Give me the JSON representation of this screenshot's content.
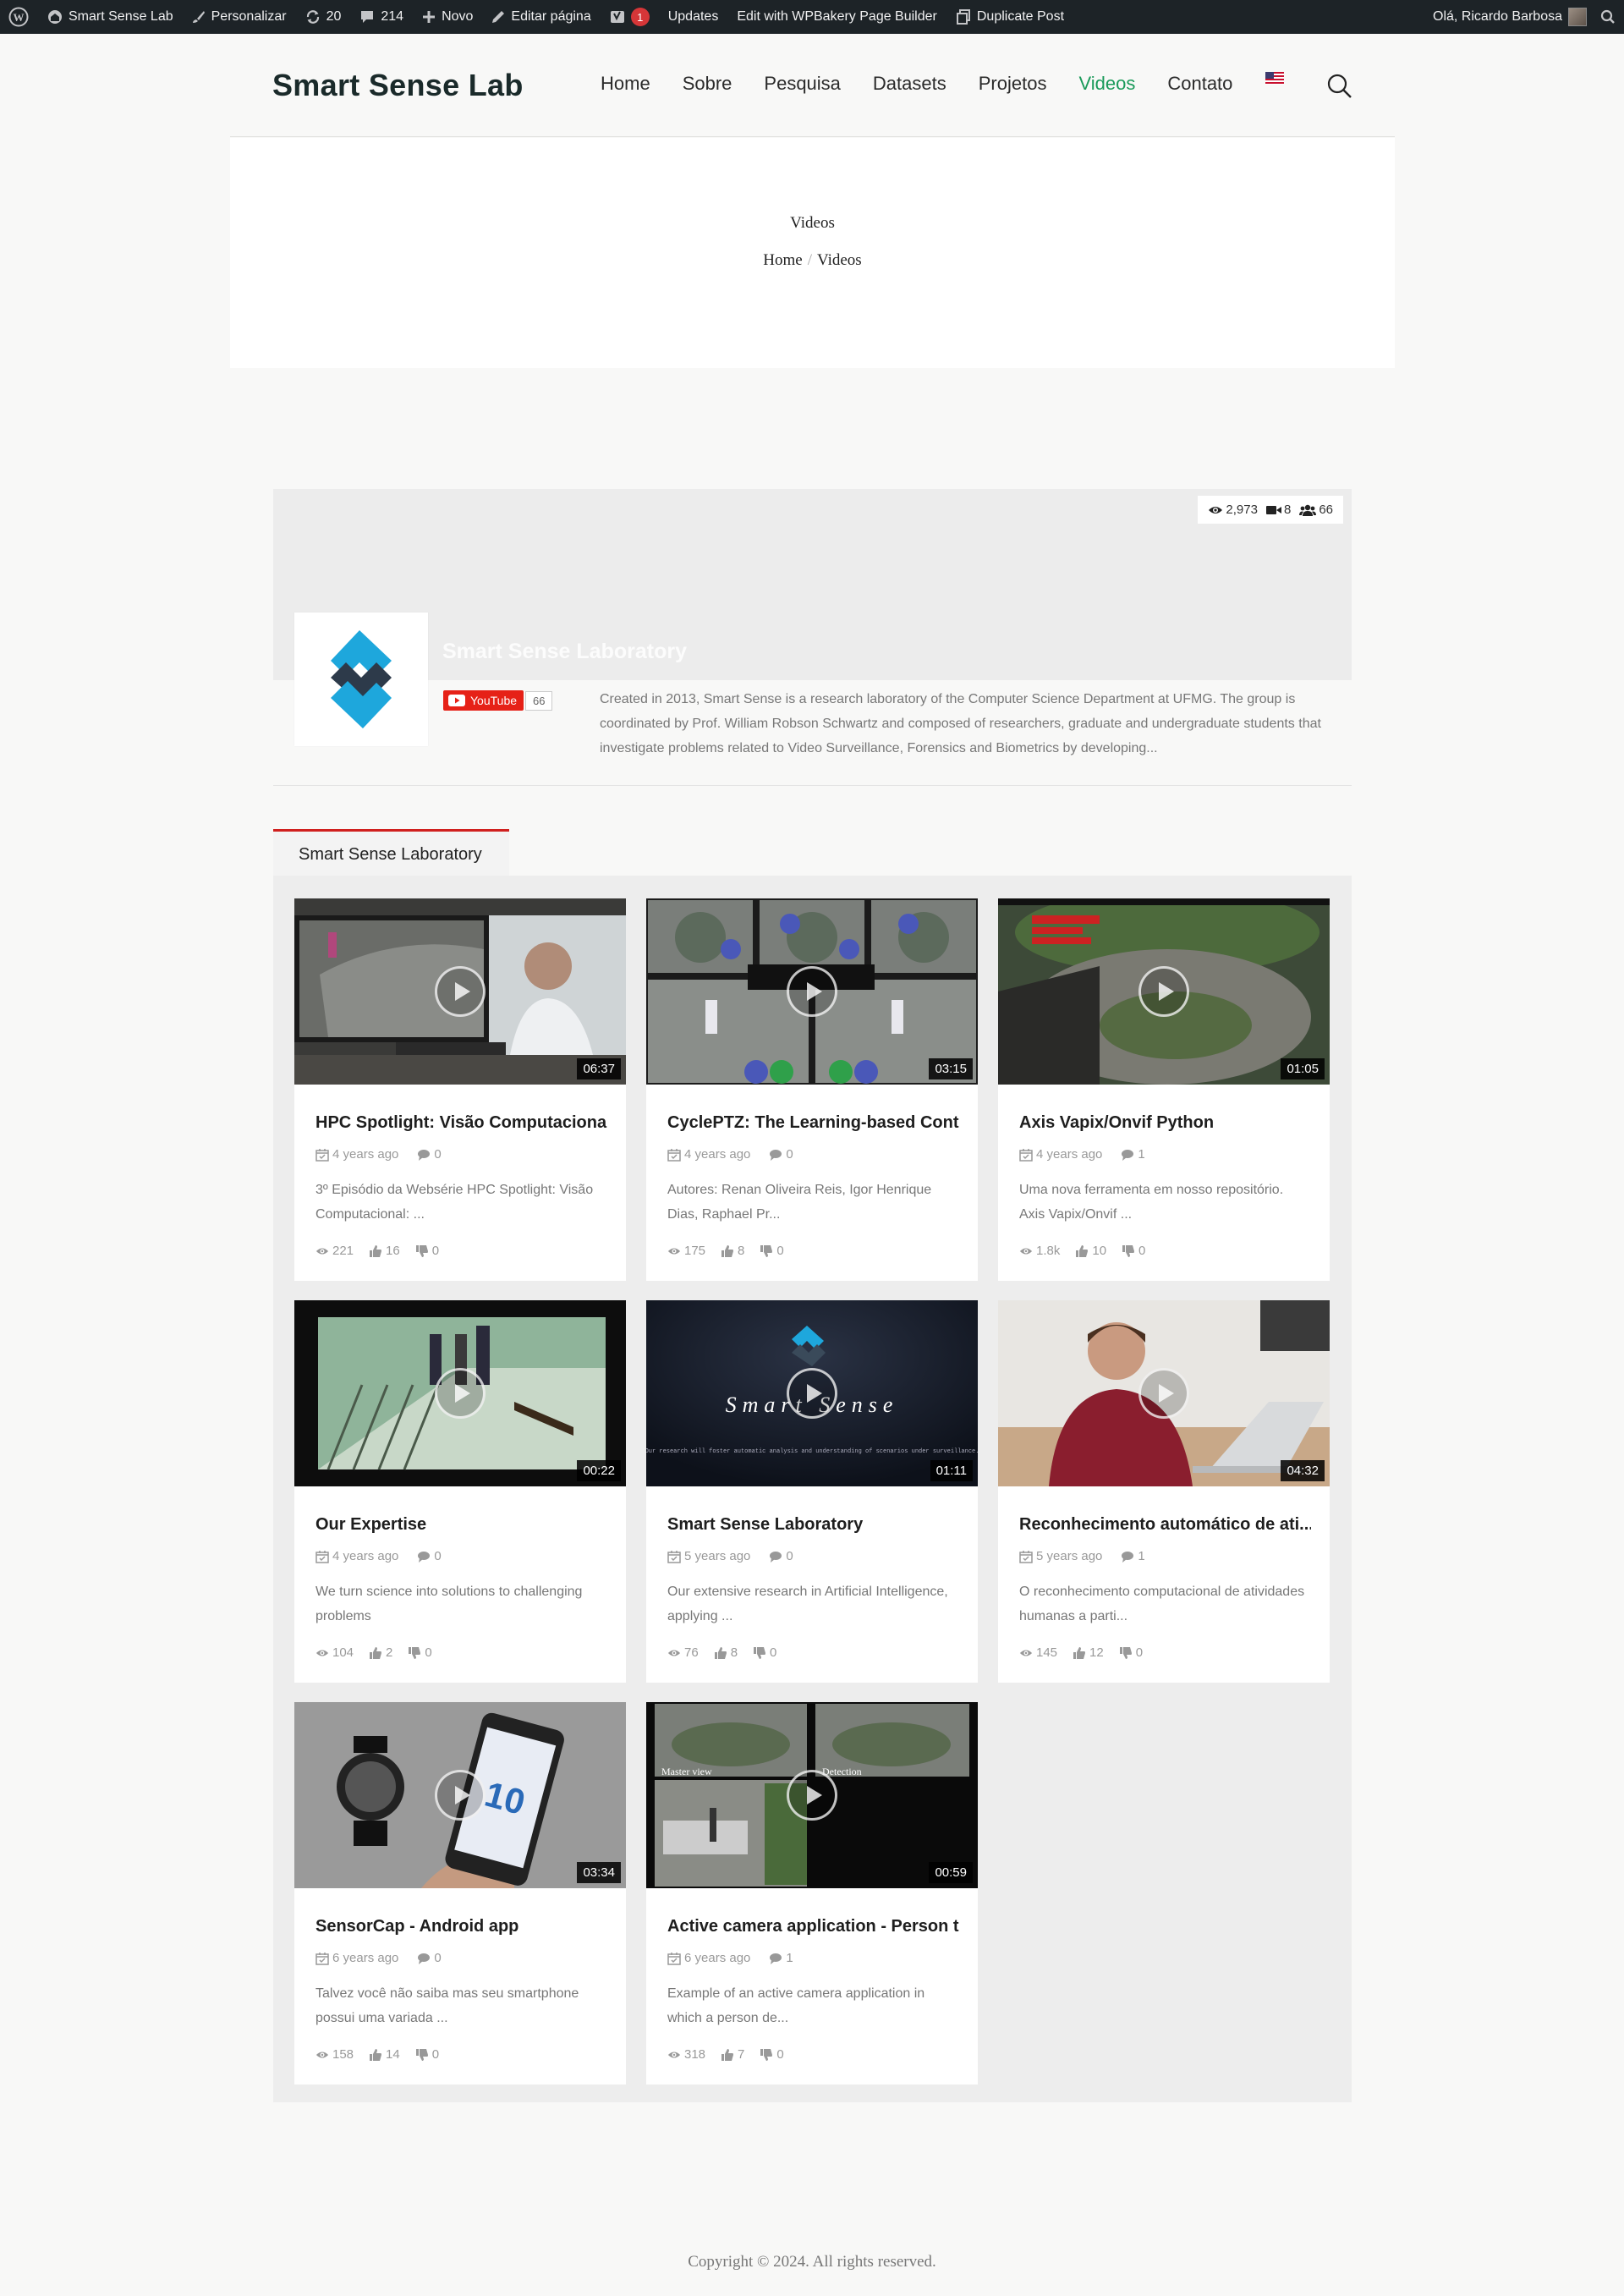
{
  "adminbar": {
    "site": "Smart Sense Lab",
    "customize": "Personalizar",
    "updates_count": "20",
    "comments_count": "214",
    "new": "Novo",
    "edit_page": "Editar página",
    "yoast_badge": "1",
    "updates": "Updates",
    "wpbakery": "Edit with WPBakery Page Builder",
    "duplicate": "Duplicate Post",
    "greeting": "Olá, Ricardo Barbosa"
  },
  "header": {
    "logo": "Smart Sense Lab",
    "nav": [
      "Home",
      "Sobre",
      "Pesquisa",
      "Datasets",
      "Projetos",
      "Videos",
      "Contato"
    ],
    "active_nav": "Videos"
  },
  "page": {
    "title": "Videos",
    "breadcrumb_home": "Home",
    "breadcrumb_sep": "/",
    "breadcrumb_current": "Videos"
  },
  "channel": {
    "views": "2,973",
    "videos": "8",
    "subscribers": "66",
    "name": "Smart Sense Laboratory",
    "youtube_label": "YouTube",
    "youtube_count": "66",
    "description": "Created in 2013, Smart Sense is a research laboratory of the Computer Science Department at UFMG. The group is coordinated by Prof. William Robson Schwartz and composed of researchers, graduate and undergraduate students that investigate problems related to Video Surveillance, Forensics and Biometrics by developing..."
  },
  "tab_label": "Smart Sense Laboratory",
  "videos": [
    {
      "title": "HPC Spotlight: Visão Computacional...",
      "duration": "06:37",
      "age": "4 years ago",
      "comments": "0",
      "desc": "3º Episódio da Websérie HPC Spotlight: Visão Computacional: ...",
      "views": "221",
      "likes": "16",
      "dislikes": "0"
    },
    {
      "title": "CyclePTZ: The Learning-based Contr...",
      "duration": "03:15",
      "age": "4 years ago",
      "comments": "0",
      "desc": "Autores: Renan Oliveira Reis, Igor Henrique Dias, Raphael Pr...",
      "views": "175",
      "likes": "8",
      "dislikes": "0"
    },
    {
      "title": "Axis Vapix/Onvif Python",
      "duration": "01:05",
      "age": "4 years ago",
      "comments": "1",
      "desc": "Uma nova ferramenta em nosso repositório. Axis Vapix/Onvif ...",
      "views": "1.8k",
      "likes": "10",
      "dislikes": "0"
    },
    {
      "title": "Our Expertise",
      "duration": "00:22",
      "age": "4 years ago",
      "comments": "0",
      "desc": "We turn science into solutions to challenging problems",
      "views": "104",
      "likes": "2",
      "dislikes": "0"
    },
    {
      "title": "Smart Sense Laboratory",
      "duration": "01:11",
      "age": "5 years ago",
      "comments": "0",
      "desc": "Our extensive research in Artificial Intelligence, applying ...",
      "views": "76",
      "likes": "8",
      "dislikes": "0"
    },
    {
      "title": "Reconhecimento automático de ati...",
      "duration": "04:32",
      "age": "5 years ago",
      "comments": "1",
      "desc": "O reconhecimento computacional de atividades humanas a parti...",
      "views": "145",
      "likes": "12",
      "dislikes": "0"
    },
    {
      "title": "SensorCap - Android app",
      "duration": "03:34",
      "age": "6 years ago",
      "comments": "0",
      "desc": "Talvez você não saiba mas seu smartphone possui uma variada ...",
      "views": "158",
      "likes": "14",
      "dislikes": "0"
    },
    {
      "title": "Active camera application - Person t...",
      "duration": "00:59",
      "age": "6 years ago",
      "comments": "1",
      "desc": "Example of an active camera application in which a person de...",
      "views": "318",
      "likes": "7",
      "dislikes": "0"
    }
  ],
  "thumb_text": {
    "smart_sense": "Smart Sense",
    "tagline": "Our research will foster automatic analysis and understanding of scenarios under surveillance.",
    "phone_number": "10",
    "master_view": "Master view",
    "detection": "Detection"
  },
  "footer": "Copyright © 2024. All rights reserved.",
  "colors": {
    "accent": "#1a9a5a",
    "tab_border": "#d0201e",
    "youtube": "#e62117",
    "adminbar": "#1d2327",
    "logo_blue": "#1ea7dc",
    "logo_dark": "#2d3a4a"
  }
}
